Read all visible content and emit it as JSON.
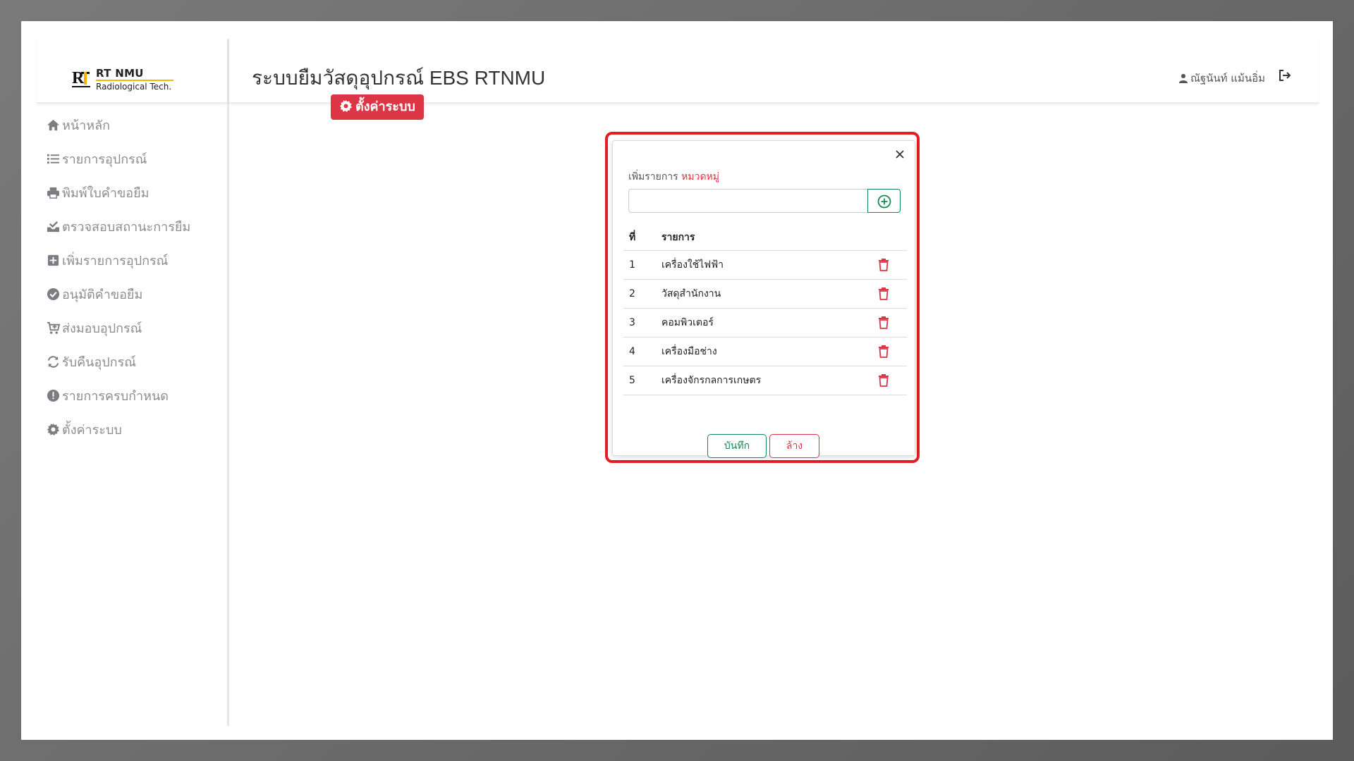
{
  "brand": {
    "line1": "RT NMU",
    "line2": "Radiological Tech."
  },
  "sidebar": {
    "items": [
      {
        "label": "หน้าหลัก",
        "icon": "home-icon"
      },
      {
        "label": "รายการอุปกรณ์",
        "icon": "list-icon"
      },
      {
        "label": "พิมพ์ใบคำขอยืม",
        "icon": "printer-icon"
      },
      {
        "label": "ตรวจสอบสถานะการยืม",
        "icon": "inbox-check-icon"
      },
      {
        "label": "เพิ่มรายการอุปกรณ์",
        "icon": "plus-square-icon"
      },
      {
        "label": "อนุมัติคำขอยืม",
        "icon": "check-circle-icon"
      },
      {
        "label": "ส่งมอบอุปกรณ์",
        "icon": "cart-plus-icon"
      },
      {
        "label": "รับคืนอุปกรณ์",
        "icon": "sync-icon"
      },
      {
        "label": "รายการครบกำหนด",
        "icon": "exclamation-circle-icon"
      },
      {
        "label": "ตั้งค่าระบบ",
        "icon": "gear-icon"
      }
    ]
  },
  "header": {
    "title": "ระบบยืมวัสดุอุปกรณ์ EBS RTNMU",
    "user_name": "ณัฐนันท์ แม้นอิ่ม"
  },
  "page_badge": "ตั้งค่าระบบ",
  "modal": {
    "add_label": "เพิ่มรายการ",
    "add_accent": "หมวดหมู่",
    "input_value": "",
    "input_placeholder": "",
    "table": {
      "headers": [
        "ที่",
        "รายการ"
      ],
      "rows": [
        {
          "no": "1",
          "name": "เครื่องใช้ไฟฟ้า"
        },
        {
          "no": "2",
          "name": "วัสดุสำนักงาน"
        },
        {
          "no": "3",
          "name": "คอมพิวเตอร์"
        },
        {
          "no": "4",
          "name": "เครื่องมือช่าง"
        },
        {
          "no": "5",
          "name": "เครื่องจักรกลการเกษตร"
        }
      ]
    },
    "save_label": "บันทึก",
    "clear_label": "ล้าง"
  },
  "colors": {
    "accent_red": "#dc3545",
    "accent_green": "#198754",
    "highlight": "#e51c23"
  }
}
